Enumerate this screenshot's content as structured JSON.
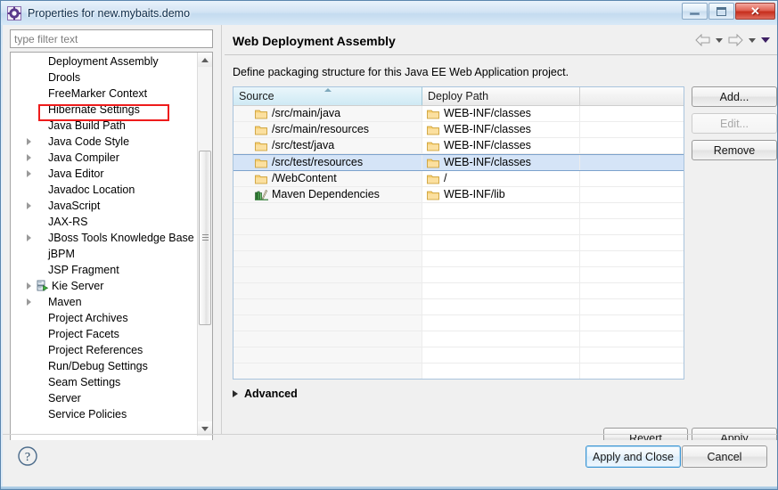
{
  "window": {
    "title": "Properties for new.mybaits.demo",
    "app_icon": "gear-icon",
    "minimize_label": "Minimize",
    "maximize_label": "Restore",
    "close_label": "Close",
    "close_glyph": "✕"
  },
  "filter": {
    "placeholder": "type filter text",
    "value": ""
  },
  "tree": {
    "items": [
      {
        "label": "Deployment Assembly",
        "expandable": false,
        "icon": null,
        "annotated": true
      },
      {
        "label": "Drools",
        "expandable": false,
        "icon": null
      },
      {
        "label": "FreeMarker Context",
        "expandable": false,
        "icon": null
      },
      {
        "label": "Hibernate Settings",
        "expandable": false,
        "icon": null
      },
      {
        "label": "Java Build Path",
        "expandable": false,
        "icon": null
      },
      {
        "label": "Java Code Style",
        "expandable": true,
        "icon": null
      },
      {
        "label": "Java Compiler",
        "expandable": true,
        "icon": null
      },
      {
        "label": "Java Editor",
        "expandable": true,
        "icon": null
      },
      {
        "label": "Javadoc Location",
        "expandable": false,
        "icon": null
      },
      {
        "label": "JavaScript",
        "expandable": true,
        "icon": null
      },
      {
        "label": "JAX-RS",
        "expandable": false,
        "icon": null
      },
      {
        "label": "JBoss Tools Knowledge Base",
        "expandable": true,
        "icon": null
      },
      {
        "label": "jBPM",
        "expandable": false,
        "icon": null
      },
      {
        "label": "JSP Fragment",
        "expandable": false,
        "icon": null
      },
      {
        "label": "Kie Server",
        "expandable": true,
        "icon": "server-run-icon"
      },
      {
        "label": "Maven",
        "expandable": true,
        "icon": null
      },
      {
        "label": "Project Archives",
        "expandable": false,
        "icon": null
      },
      {
        "label": "Project Facets",
        "expandable": false,
        "icon": null
      },
      {
        "label": "Project References",
        "expandable": false,
        "icon": null
      },
      {
        "label": "Run/Debug Settings",
        "expandable": false,
        "icon": null
      },
      {
        "label": "Seam Settings",
        "expandable": false,
        "icon": null
      },
      {
        "label": "Server",
        "expandable": false,
        "icon": null
      },
      {
        "label": "Service Policies",
        "expandable": false,
        "icon": null
      }
    ]
  },
  "page": {
    "title": "Web Deployment Assembly",
    "description": "Define packaging structure for this Java EE Web Application project.",
    "nav": {
      "back_icon": "back-arrow-icon",
      "back_menu_icon": "chevron-down-icon",
      "forward_icon": "forward-arrow-icon",
      "forward_menu_icon": "chevron-down-icon",
      "view_menu_icon": "chevron-down-filled-icon"
    }
  },
  "table": {
    "columns": [
      "Source",
      "Deploy Path",
      ""
    ],
    "sorted_column_index": 0,
    "sort_direction": "ascending",
    "selected_row_index": 3,
    "rows": [
      {
        "source": "/src/main/java",
        "source_icon": "folder-icon",
        "deploy": "WEB-INF/classes",
        "deploy_icon": "folder-icon"
      },
      {
        "source": "/src/main/resources",
        "source_icon": "folder-icon",
        "deploy": "WEB-INF/classes",
        "deploy_icon": "folder-icon"
      },
      {
        "source": "/src/test/java",
        "source_icon": "folder-icon",
        "deploy": "WEB-INF/classes",
        "deploy_icon": "folder-icon"
      },
      {
        "source": "/src/test/resources",
        "source_icon": "folder-icon",
        "deploy": "WEB-INF/classes",
        "deploy_icon": "folder-icon"
      },
      {
        "source": "/WebContent",
        "source_icon": "folder-icon",
        "deploy": "/",
        "deploy_icon": "folder-icon"
      },
      {
        "source": "Maven Dependencies",
        "source_icon": "maven-library-icon",
        "deploy": "WEB-INF/lib",
        "deploy_icon": "folder-icon"
      }
    ],
    "empty_row_count": 11
  },
  "side_buttons": {
    "add": "Add...",
    "edit": "Edit...",
    "edit_disabled": true,
    "remove": "Remove"
  },
  "advanced": {
    "label": "Advanced",
    "expanded": false,
    "icon": "expander-right-icon"
  },
  "footer": {
    "revert": "Revert",
    "apply": "Apply",
    "apply_and_close": "Apply and Close",
    "cancel": "Cancel",
    "help_icon": "help-question-icon"
  },
  "colors": {
    "accent": "#3c96d4",
    "selection": "#d5e4f7",
    "annotation": "#ee1c1c",
    "title_bar": "#c4dbef",
    "folder": "#f6c761"
  }
}
